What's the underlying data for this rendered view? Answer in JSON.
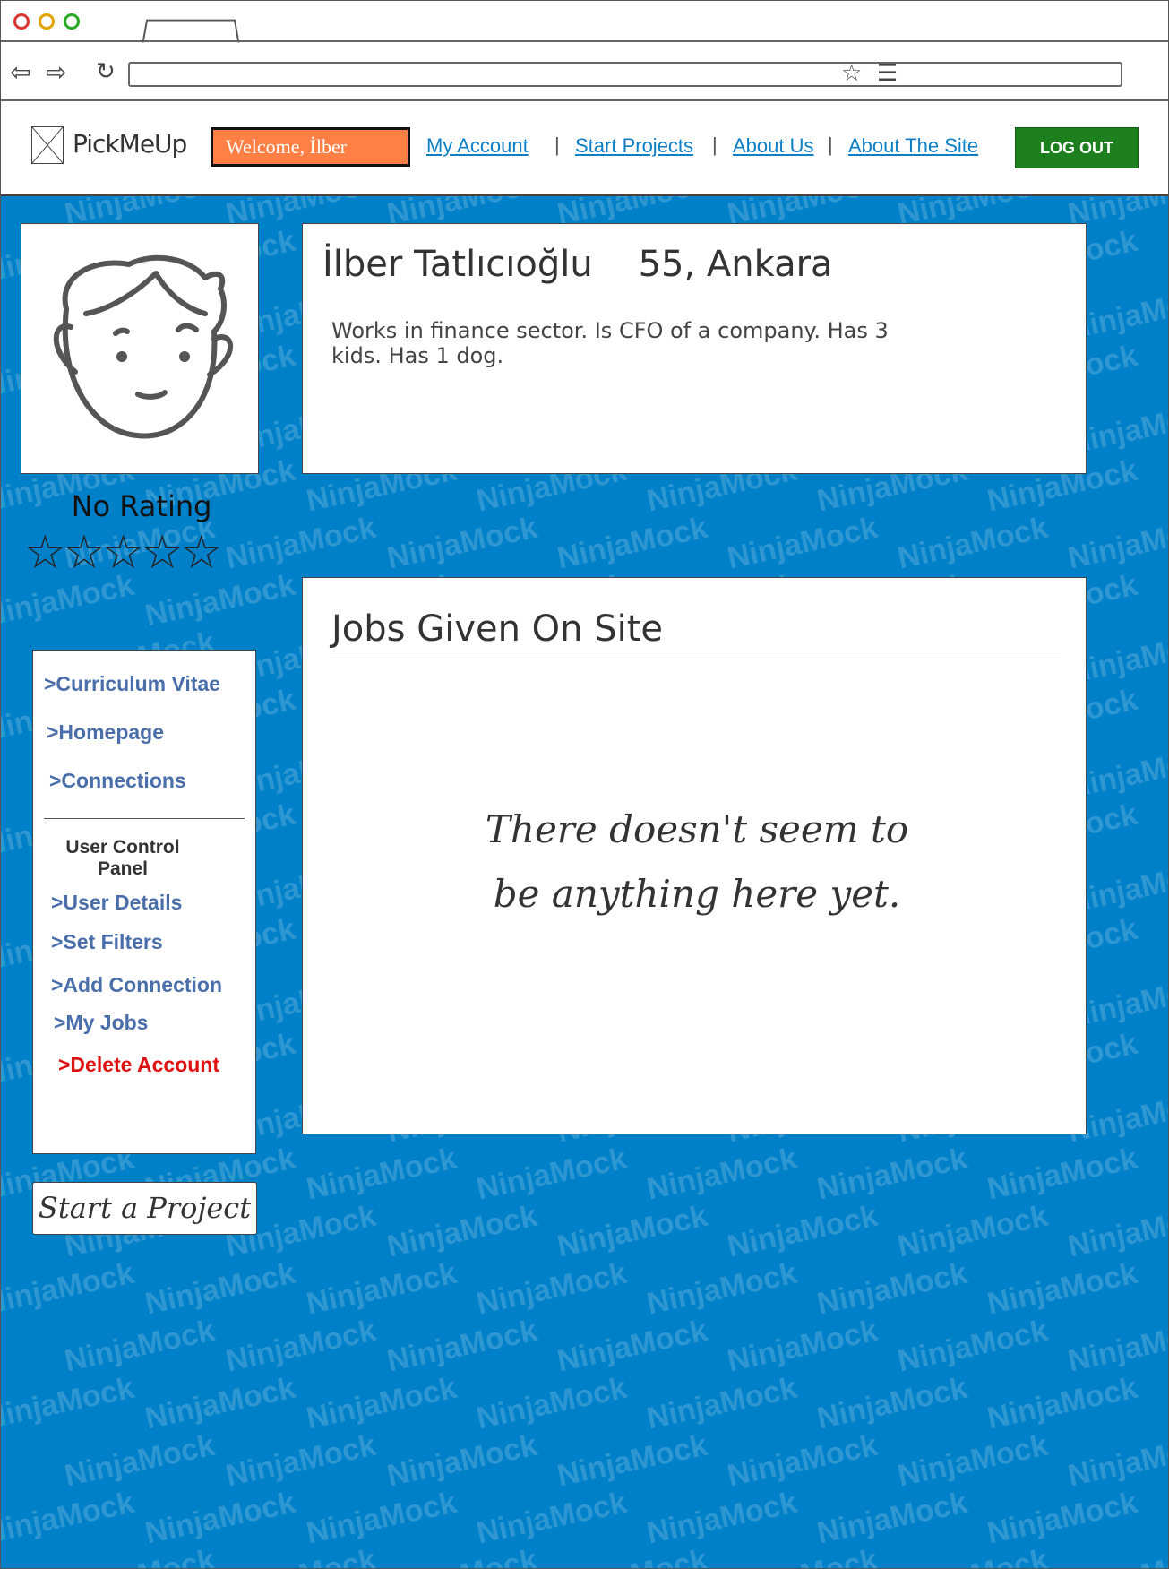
{
  "browser": {
    "tab_title": "",
    "url": "",
    "icons": [
      "back-arrow-icon",
      "forward-arrow-icon",
      "reload-icon",
      "bookmark-star-icon",
      "menu-icon"
    ]
  },
  "header": {
    "logo_text": "PickMeUp",
    "welcome": "Welcome, İlber",
    "links": [
      "My Account",
      "Start Projects",
      "About Us",
      "About The Site"
    ],
    "separator": "|",
    "logout": "LOG OUT"
  },
  "profile": {
    "name_line": "İlber Tatlıcıoğlu    55, Ankara",
    "bio": "Works in finance sector. Is CFO of a company. Has 3 kids. Has 1 dog.",
    "rating_label": "No Rating",
    "stars_filled": 0,
    "stars_total": 5
  },
  "sidebar": {
    "top_items": [
      ">Curriculum Vitae",
      ">Homepage",
      ">Connections"
    ],
    "panel_title": "User Control Panel",
    "panel_items": [
      ">User Details",
      ">Set Filters",
      ">Add Connection",
      ">My Jobs"
    ],
    "danger_item": ">Delete Account",
    "start_project": "Start a Project"
  },
  "jobs": {
    "title": "Jobs Given On Site",
    "empty_line1": "There doesn't seem to",
    "empty_line2": "be anything here yet."
  },
  "watermark": "NinjaMock",
  "colors": {
    "background": "#0080c9",
    "welcome_bg": "#ff7f45",
    "logout_bg": "#1e7f1e",
    "link": "#0f7fc4",
    "menu_link": "#4a6eaa",
    "danger": "#e01010"
  }
}
